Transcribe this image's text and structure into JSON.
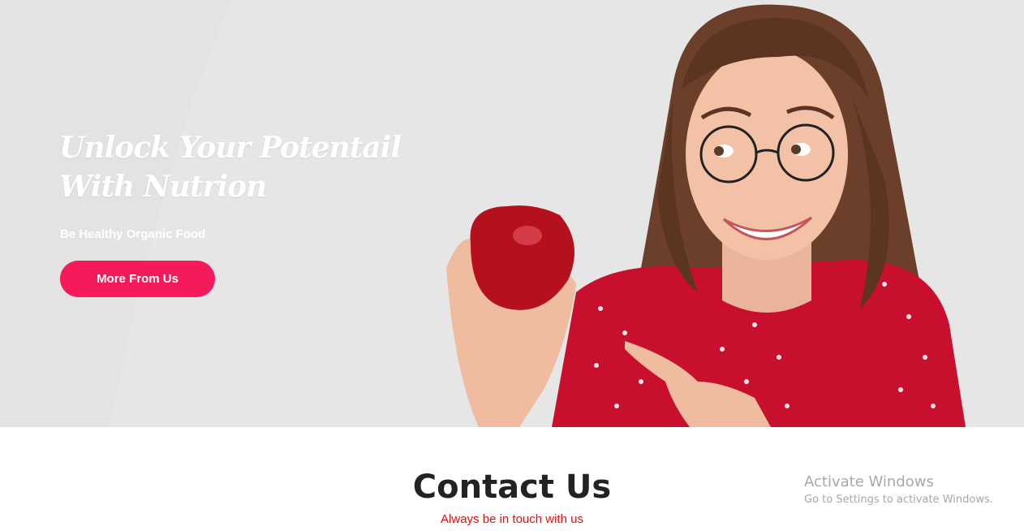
{
  "hero": {
    "title": "Unlock Your Potentail With Nutrion",
    "subtitle": "Be Healthy Organic Food",
    "button_label": "More From Us",
    "image": "woman-holding-red-apple-pointing-photo",
    "colors": {
      "background": "#e6e6e6",
      "button": "#f51a5a",
      "title_text": "#ffffff"
    }
  },
  "contact": {
    "title": "Contact Us",
    "subtitle": "Always be in touch with us",
    "subtitle_color": "#e01010"
  },
  "watermark": {
    "title": "Activate Windows",
    "message": "Go to Settings to activate Windows."
  }
}
